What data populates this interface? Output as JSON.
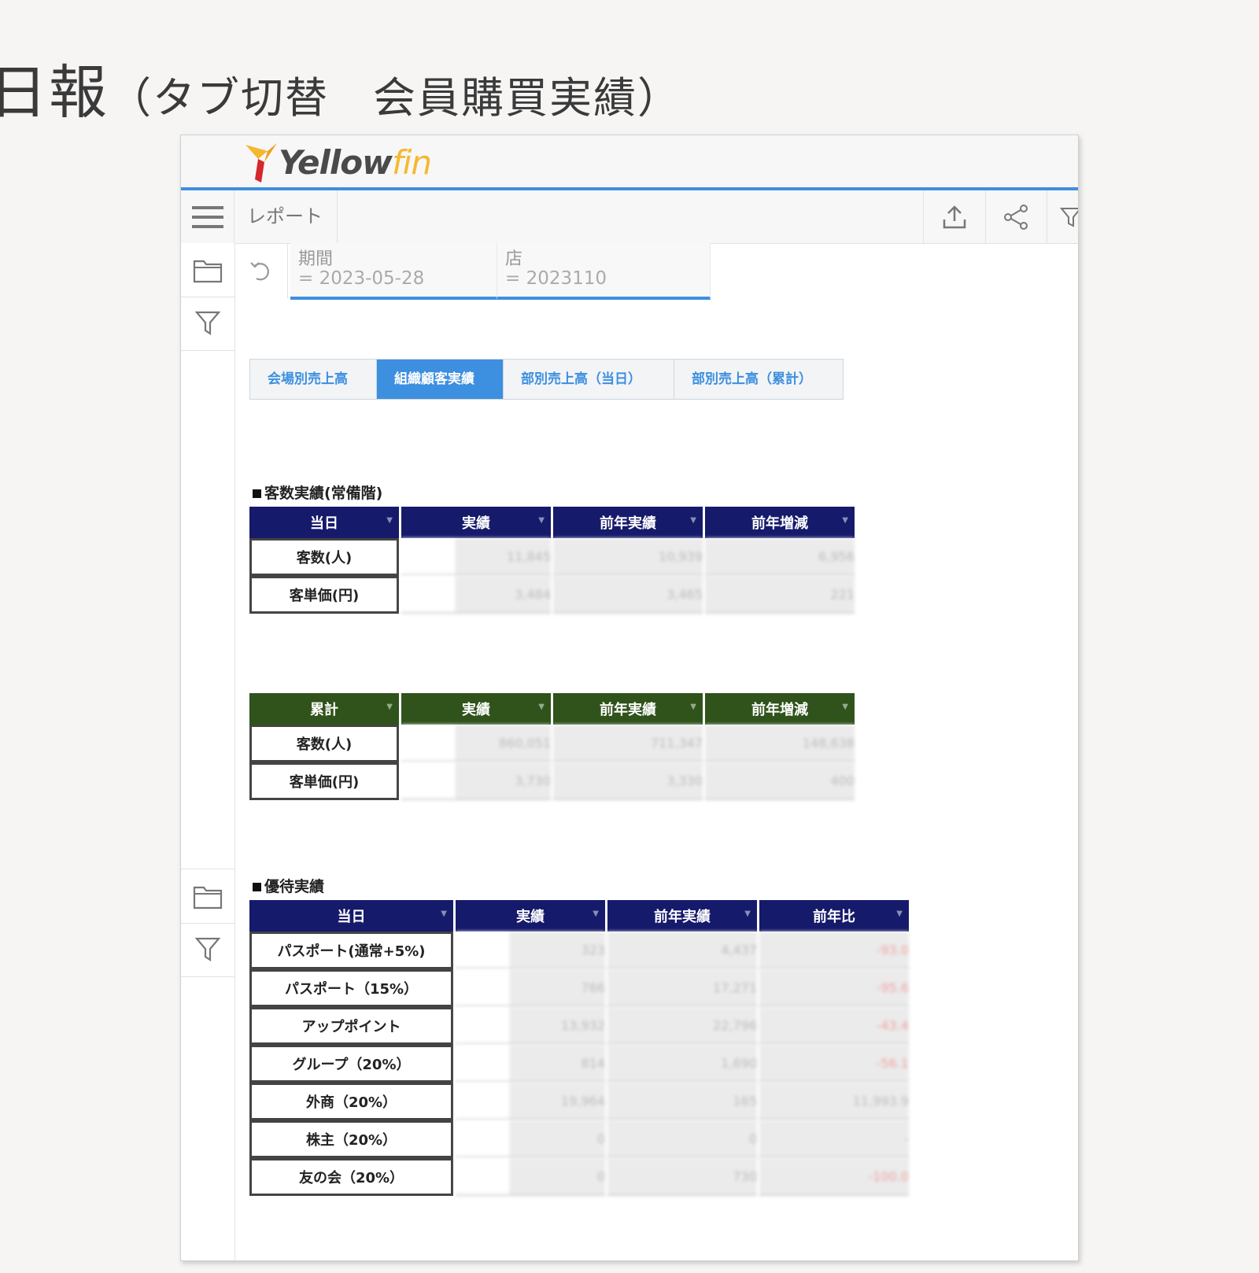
{
  "slide": {
    "title": "日報",
    "subtitle": "（タブ切替　会員購買実績）"
  },
  "app": {
    "logo": {
      "main": "Yellow",
      "accent": "fin"
    },
    "toolbar": {
      "report_label": "レポート"
    },
    "filters": [
      {
        "name": "期間",
        "value": "= 2023-05-28"
      },
      {
        "name": "店",
        "value": "= 2023110"
      }
    ],
    "tabs": [
      {
        "label": "会場別売上高",
        "active": false
      },
      {
        "label": "組織顧客実績",
        "active": true
      },
      {
        "label": "部別売上高（当日）",
        "active": false
      },
      {
        "label": "部別売上高（累計）",
        "active": false
      }
    ],
    "section1": {
      "title": "客数実績(常備階)",
      "daily": {
        "headers": [
          "当日",
          "実績",
          "前年実績",
          "前年増減"
        ],
        "rows": [
          {
            "label": "客数(人)",
            "values": [
              "11,845",
              "10,939",
              "6,956"
            ]
          },
          {
            "label": "客単価(円)",
            "values": [
              "3,484",
              "3,465",
              "221"
            ]
          }
        ]
      },
      "cumulative": {
        "headers": [
          "累計",
          "実績",
          "前年実績",
          "前年増減"
        ],
        "rows": [
          {
            "label": "客数(人)",
            "values": [
              "860,051",
              "711,347",
              "148,638"
            ]
          },
          {
            "label": "客単価(円)",
            "values": [
              "3,730",
              "3,330",
              "400"
            ]
          }
        ]
      }
    },
    "section2": {
      "title": "優待実績",
      "headers": [
        "当日",
        "実績",
        "前年実績",
        "前年比"
      ],
      "rows": [
        {
          "label": "パスポート(通常+5%)",
          "values": [
            "323",
            "4,437",
            "-93.0"
          ]
        },
        {
          "label": "パスポート（15%）",
          "values": [
            "766",
            "17,271",
            "-95.6"
          ]
        },
        {
          "label": "アップポイント",
          "values": [
            "13,932",
            "22,796",
            "-43.4"
          ]
        },
        {
          "label": "グループ（20%）",
          "values": [
            "814",
            "1,690",
            "-56.1"
          ]
        },
        {
          "label": "外商（20%）",
          "values": [
            "19,964",
            "165",
            "11,993.9"
          ]
        },
        {
          "label": "株主（20%）",
          "values": [
            "0",
            "0",
            "-"
          ]
        },
        {
          "label": "友の会（20%）",
          "values": [
            "0",
            "730",
            "-100.0"
          ]
        }
      ]
    }
  }
}
